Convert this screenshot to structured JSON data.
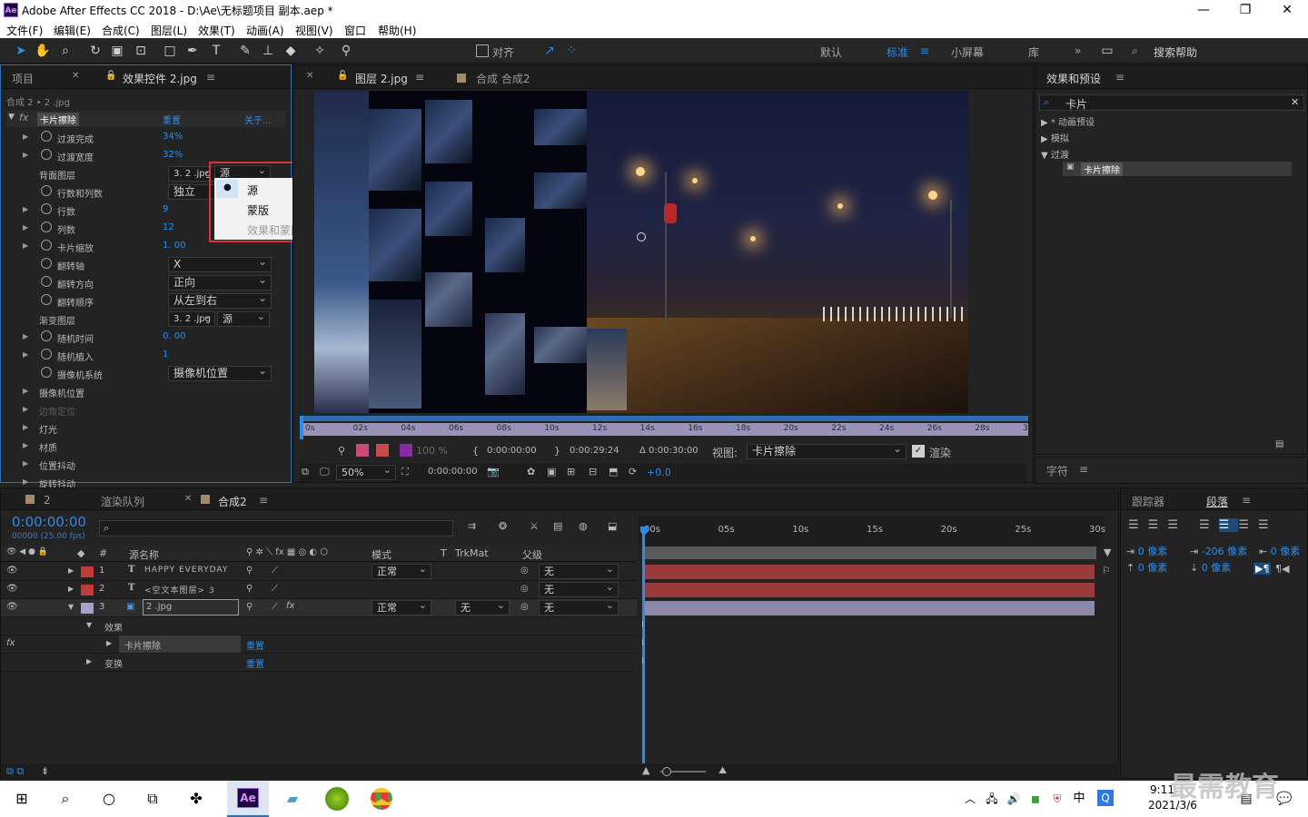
{
  "window": {
    "app_badge": "Ae",
    "title": "Adobe After Effects CC 2018 - D:\\Ae\\无标题项目 副本.aep *",
    "controls": {
      "minimize": "—",
      "restore": "❐",
      "close": "✕"
    }
  },
  "menu": [
    "文件(F)",
    "编辑(E)",
    "合成(C)",
    "图层(L)",
    "效果(T)",
    "动画(A)",
    "视图(V)",
    "窗口",
    "帮助(H)"
  ],
  "toolbar": {
    "snap_label": "对齐",
    "workspaces": [
      "默认",
      "标准",
      "小屏幕",
      "库"
    ],
    "active_workspace": "标准",
    "search_placeholder": "搜索帮助"
  },
  "effect_controls": {
    "tabs": [
      "项目",
      "效果控件 2.jpg"
    ],
    "breadcrumb": "合成 2 • 2 .jpg",
    "effect_name": "卡片擦除",
    "reset_label": "重置",
    "about_label": "关于...",
    "props": [
      {
        "label": "过渡完成",
        "value": "34%"
      },
      {
        "label": "过渡宽度",
        "value": "32%"
      },
      {
        "label": "背面图层",
        "value": "3. 2 .jpg"
      },
      {
        "label": "行数和列数",
        "value": "独立"
      },
      {
        "label": "行数",
        "value": "9"
      },
      {
        "label": "列数",
        "value": "12"
      },
      {
        "label": "卡片缩放",
        "value": "1. 00"
      },
      {
        "label": "翻转轴",
        "value": "X"
      },
      {
        "label": "翻转方向",
        "value": "正向"
      },
      {
        "label": "翻转顺序",
        "value": "从左到右"
      },
      {
        "label": "渐变图层",
        "value": "3. 2 .jpg"
      },
      {
        "label": "随机时间",
        "value": "0. 00"
      },
      {
        "label": "随机植入",
        "value": "1"
      },
      {
        "label": "摄像机系统",
        "value": "摄像机位置"
      },
      {
        "label": "摄像机位置",
        "value": ""
      },
      {
        "label": "边角定位",
        "value": ""
      },
      {
        "label": "灯光",
        "value": ""
      },
      {
        "label": "材质",
        "value": ""
      },
      {
        "label": "位置抖动",
        "value": ""
      },
      {
        "label": "旋转抖动",
        "value": ""
      }
    ],
    "source_dropdown": "源",
    "source_dropdown_2": "源",
    "popup_options": [
      {
        "label": "源",
        "selected": true,
        "enabled": true
      },
      {
        "label": "蒙版",
        "selected": false,
        "enabled": true
      },
      {
        "label": "效果和蒙版",
        "selected": false,
        "enabled": false
      }
    ]
  },
  "composition": {
    "tabs": [
      "图层 2.jpg",
      "合成 合成2"
    ],
    "ruler_ticks": [
      "0s",
      "02s",
      "04s",
      "06s",
      "08s",
      "10s",
      "12s",
      "14s",
      "16s",
      "18s",
      "20s",
      "22s",
      "24s",
      "26s",
      "28s",
      "30s"
    ],
    "in_time": "0:00:00:00",
    "out_time": "0:00:29:24",
    "duration": "Δ 0:00:30:00",
    "view_label": "视图:",
    "view_value": "卡片擦除",
    "render_label": "渲染",
    "opacity": "100 %",
    "zoom": "50%",
    "current_time": "0:00:00:00",
    "exposure": "+0.0"
  },
  "effects_presets": {
    "title": "效果和预设",
    "search_value": "卡片",
    "tree": [
      {
        "label": "* 动画预设",
        "expanded": false
      },
      {
        "label": "模拟",
        "expanded": false
      },
      {
        "label": "过渡",
        "expanded": true
      }
    ],
    "match": "卡片擦除"
  },
  "character_panel": {
    "title": "字符"
  },
  "paragraph_panel": {
    "tabs": [
      "跟踪器",
      "段落"
    ],
    "indent_left": "0 像素",
    "indent_right": "0 像素",
    "first_line": "-206 像素",
    "space_before": "0 像素",
    "space_after": "0 像素"
  },
  "timeline": {
    "tabs": [
      "2",
      "渲染队列",
      "合成2"
    ],
    "timecode": "0:00:00:00",
    "frame_info": "00000 (25.00 fps)",
    "columns": {
      "name": "源名称",
      "mode": "模式",
      "t": "T",
      "trkmat": "TrkMat",
      "parent": "父级"
    },
    "layers": [
      {
        "num": "1",
        "type": "T",
        "name": "HAPPY EVERYDAY",
        "mode": "正常",
        "trkmat": "",
        "parent": "无",
        "color": "#c23a3a"
      },
      {
        "num": "2",
        "type": "T",
        "name": "<空文本图层> 3",
        "mode": "",
        "trkmat": "",
        "parent": "无",
        "color": "#c23a3a"
      },
      {
        "num": "3",
        "type": "",
        "name": "2 .jpg",
        "mode": "正常",
        "trkmat": "无",
        "parent": "无",
        "color": "#a8a0c8"
      }
    ],
    "sub_effects": "效果",
    "sub_effect_name": "卡片擦除",
    "sub_reset": "重置",
    "sub_transform": "变换",
    "sub_transform_reset": "重置",
    "ruler_ticks": [
      "00s",
      "05s",
      "10s",
      "15s",
      "20s",
      "25s",
      "30s"
    ]
  },
  "taskbar": {
    "time": "9:11",
    "date": "2021/3/6",
    "ime": "中",
    "watermark": "最需教育"
  },
  "colors": {
    "accent_blue": "#2d8ceb",
    "popup_border": "#d6343c",
    "layer_red": "#c23a3a",
    "layer_lavender": "#a8a0c8"
  }
}
